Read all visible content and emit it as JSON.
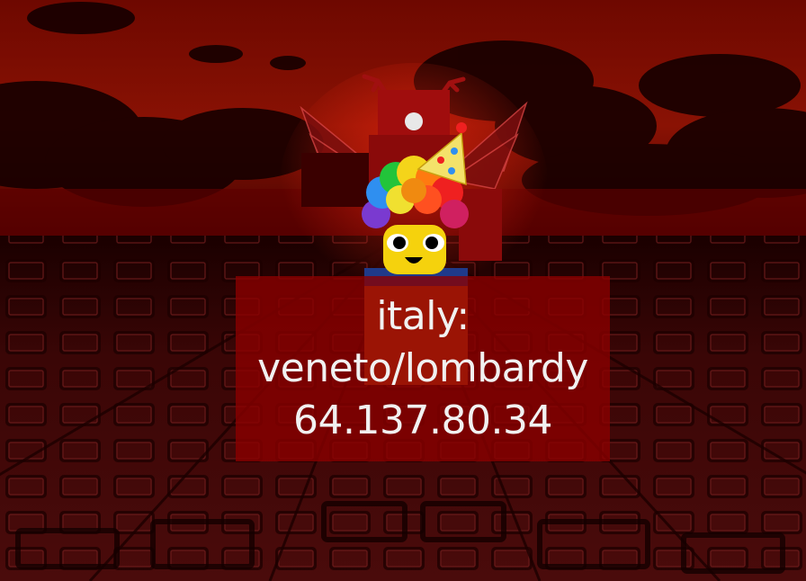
{
  "label": {
    "lines": [
      "italy:",
      "veneto/lombardy",
      "64.137.80.34"
    ]
  },
  "colors": {
    "sky_top": "#7a0a00",
    "sky_bottom": "#3a0000",
    "baseplate": "#3d0808",
    "panel_bg": "#8c0000",
    "text": "#f1f1f1"
  },
  "scene": {
    "icons": [
      "dark-cloud",
      "baseplate-stud",
      "clown-afro-hat",
      "party-hat",
      "red-antlers",
      "blade-wings"
    ]
  }
}
